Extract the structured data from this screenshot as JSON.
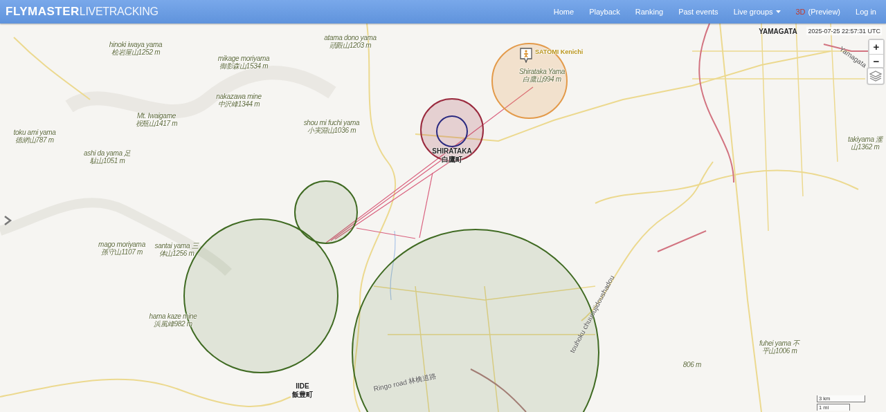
{
  "header": {
    "logo_bold": "FLYMASTER",
    "logo_light": "LIVETRACKING",
    "nav": [
      {
        "label": "Home",
        "kind": "link"
      },
      {
        "label": "Playback",
        "kind": "link"
      },
      {
        "label": "Ranking",
        "kind": "link"
      },
      {
        "label": "Past events",
        "kind": "link"
      },
      {
        "label": "Live groups",
        "kind": "dropdown"
      },
      {
        "accent": "3D",
        "label": "(Preview)",
        "kind": "preview"
      },
      {
        "label": "Log in",
        "kind": "link"
      }
    ]
  },
  "map": {
    "timestamp": "2025-07-25 22:57:31 UTC",
    "zoom_in": "+",
    "zoom_out": "−",
    "places": [
      {
        "name": "YAMAGATA"
      },
      {
        "name": "SHIRATAKA",
        "local": "白鷹町"
      },
      {
        "name": "IIDE",
        "local": "飯豊町"
      }
    ],
    "peaks": [
      {
        "romaji": "hinoki iwaya yama",
        "local": "桧岩屋山1252 m"
      },
      {
        "romaji": "atama dono yama",
        "local": "頭殿山1203 m"
      },
      {
        "romaji": "mikage moriyama",
        "local": "御影森山1534 m"
      },
      {
        "romaji": "nakazawa mine",
        "local": "中沢峰1344 m"
      },
      {
        "romaji": "Mt. Iwaigame",
        "local": "祝瓶山1417 m"
      },
      {
        "romaji": "shou mi fuchi yama",
        "local": "小実淵山1036 m"
      },
      {
        "romaji": "toku ami yama",
        "local": "徳網山787 m"
      },
      {
        "romaji": "ashi da yama 足",
        "local": "駄山1051 m"
      },
      {
        "romaji": "mago moriyama",
        "local": "孫守山1107 m"
      },
      {
        "romaji": "santai yama 三",
        "local": "体山1256 m"
      },
      {
        "romaji": "hama kaze mine",
        "local": "浜風峰982 m"
      },
      {
        "romaji": "Shirataka Yama",
        "local": "白鷹山994 m"
      },
      {
        "romaji": "takiyama 瀧",
        "local": "山1362 m"
      },
      {
        "romaji": "fuhei yama 不",
        "local": "平山1006 m"
      },
      {
        "local": "806 m"
      }
    ],
    "roads": [
      {
        "label": "touhoku chuuoujidoushadou"
      },
      {
        "label": "Ringo road 林檎道路"
      },
      {
        "label": "Yamagata"
      }
    ],
    "pilot": {
      "label": "SATOMI Kenichi"
    },
    "task_circles": [
      {
        "color": "#e39a4a"
      },
      {
        "color": "#9a2a3e"
      },
      {
        "color": "#2a2a80"
      },
      {
        "color": "#3f6a22"
      },
      {
        "color": "#3f6a22"
      },
      {
        "color": "#3f6a22"
      }
    ],
    "scale": [
      "3 km",
      "1 mi"
    ]
  }
}
